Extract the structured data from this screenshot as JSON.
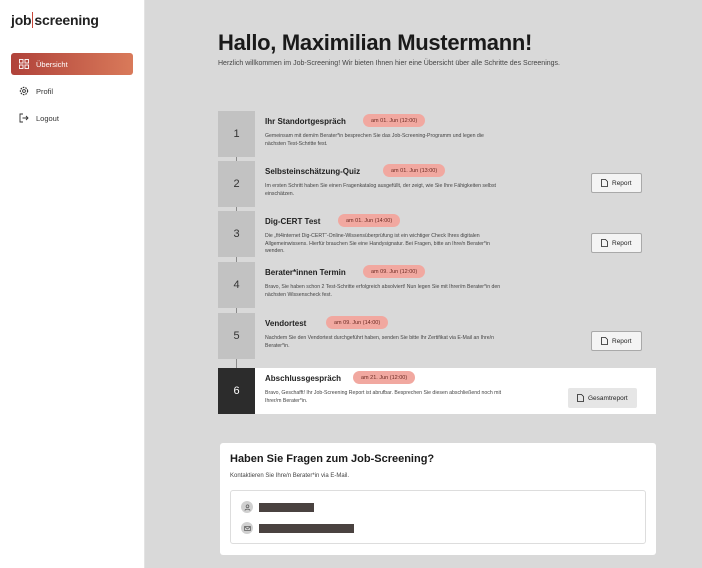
{
  "logo": {
    "part1": "job",
    "part2": "screening"
  },
  "nav": [
    {
      "label": "Übersicht",
      "icon": "grid-icon",
      "active": true
    },
    {
      "label": "Profil",
      "icon": "gear-icon",
      "active": false
    },
    {
      "label": "Logout",
      "icon": "logout-icon",
      "active": false
    }
  ],
  "header": {
    "title": "Hallo, Maximilian Mustermann!",
    "subtitle": "Herzlich willkommen im Job-Screening! Wir bieten Ihnen hier eine Übersicht über alle Schritte des Screenings."
  },
  "steps": [
    {
      "num": "1",
      "title": "Ihr Standortgespräch",
      "date": "am 01. Jun (12:00)",
      "desc": "Gemeinsam mit dem/m Berater*in besprechen Sie das Job-Screening-Programm und legen die nächsten Test-Schritte fest.",
      "button": ""
    },
    {
      "num": "2",
      "title": "Selbsteinschätzung-Quiz",
      "date": "am 01. Jun (13:00)",
      "desc": "Im ersten Schritt haben Sie einen Fragenkatalog ausgefüllt, der zeigt, wie Sie Ihre Fähigkeiten selbst einschätzen.",
      "button": "Report"
    },
    {
      "num": "3",
      "title": "Dig-CERT Test",
      "date": "am 01. Jun (14:00)",
      "desc": "Die „fit4internet Dig-CERT“-Online-Wissensüberprüfung ist ein wichtiger Check Ihres digitalen Allgemeinwissens. Hierfür brauchen Sie eine Handysignatur. Bei Fragen, bitte an Ihre/n Berater*in wenden.",
      "button": "Report"
    },
    {
      "num": "4",
      "title": "Berater*innen Termin",
      "date": "am 09. Jun (12:00)",
      "desc": "Bravo, Sie haben schon 2 Test-Schritte erfolgreich absolviert! Nun legen Sie mit Ihrer/m Berater*in den nächsten Wissenscheck fest.",
      "button": ""
    },
    {
      "num": "5",
      "title": "Vendortest",
      "date": "am 09. Jun (14:00)",
      "desc": "Nachdem Sie den Vendortest durchgeführt haben, senden Sie bitte Ihr Zertifikat via E-Mail an Ihre/n Berater*in.",
      "button": "Report"
    },
    {
      "num": "6",
      "title": "Abschlussgespräch",
      "date": "am 21. Jun (12:00)",
      "desc": "Bravo, Geschafft! Ihr Job-Screening Report ist abrufbar. Besprechen Sie diesen abschließend noch mit Ihrer/m Berater*in.",
      "button": "Gesamtreport"
    }
  ],
  "contact": {
    "title": "Haben Sie Fragen zum Job-Screening?",
    "text": "Kontaktieren Sie Ihre/n Berater*in via E-Mail."
  },
  "colors": {
    "accent": "#c7463a",
    "badge": "#f1a8a0",
    "current_step": "#2c2c2c"
  }
}
